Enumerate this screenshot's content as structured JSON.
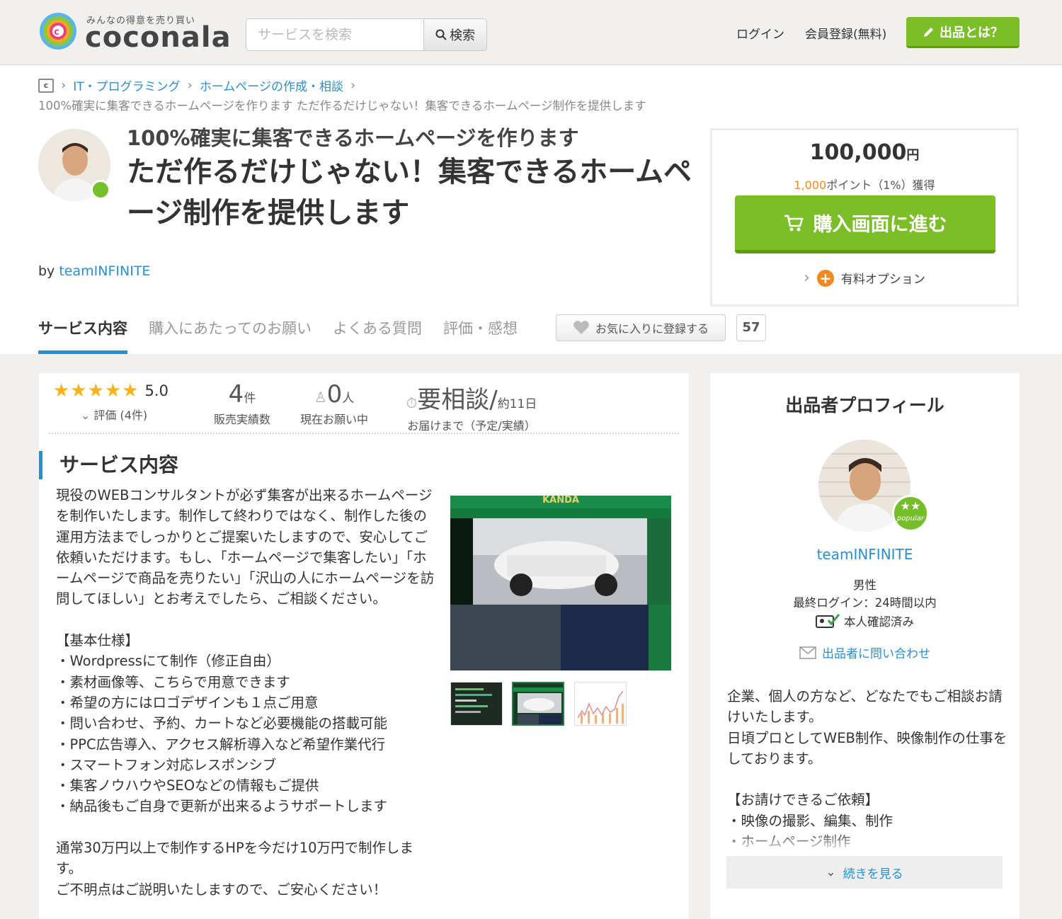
{
  "header": {
    "logo_tagline": "みんなの得意を売り買い",
    "logo_word": "coconala",
    "search_placeholder": "サービスを検索",
    "search_button": "検索",
    "login": "ログイン",
    "register": "会員登録(無料)",
    "sell_button": "出品とは？"
  },
  "breadcrumb": {
    "items": [
      "IT・プログラミング",
      "ホームページの作成・相談"
    ],
    "current": "100%確実に集客できるホームページを作ります ただ作るだけじゃない！集客できるホームページ制作を提供します"
  },
  "service": {
    "title_sub": "100%確実に集客できるホームページを作ります",
    "title_main": "ただ作るだけじゃない！集客できるホームページ制作を提供します",
    "by_label": "by",
    "seller": "teamINFINITE"
  },
  "price_box": {
    "price": "100,000",
    "currency": "円",
    "points_value": "1,000",
    "points_text": "ポイント（1%）獲得",
    "buy_button": "購入画面に進む",
    "option_label": "有料オプション"
  },
  "tabs": [
    {
      "label": "サービス内容",
      "active": true
    },
    {
      "label": "購入にあたってのお願い",
      "active": false
    },
    {
      "label": "よくある質問",
      "active": false
    },
    {
      "label": "評価・感想",
      "active": false
    }
  ],
  "favorite": {
    "label": "お気に入りに登録する",
    "count": "57"
  },
  "stats": {
    "rating_stars": "★★★★★",
    "rating_score": "5.0",
    "rating_label": "評価 (4件)",
    "sales_count": "4",
    "sales_unit": "件",
    "sales_label": "販売実績数",
    "requests_count": "0",
    "requests_unit": "人",
    "requests_label": "現在お願い中",
    "delivery_value": "要相談",
    "delivery_sep": "/",
    "delivery_actual": "約11日",
    "delivery_label": "お届けまで（予定/実績）"
  },
  "content": {
    "section_title": "サービス内容",
    "description": "現役のWEBコンサルタントが必ず集客が出来るホームページを制作いたします。制作して終わりではなく、制作した後の運用方法までしっかりとご提案いたしますので、安心してご依頼いただけます。もし、「ホームページで集客したい」「ホームページで商品を売りたい」「沢山の人にホームページを訪問してほしい」とお考えでしたら、ご相談ください。\n\n【基本仕様】\n・Wordpressにて制作（修正自由）\n・素材画像等、こちらで用意できます\n・希望の方にはロゴデザインも１点ご用意\n・問い合わせ、予約、カートなど必要機能の搭載可能\n・PPC広告導入、アクセス解析導入など希望作業代行\n・スマートフォン対応レスポンシブ\n・集客ノウハウやSEOなどの情報もご提供\n・納品後もご自身で更新が出来るようサポートします\n\n通常30万円以上で制作するHPを今だけ10万円で制作します。\nご不明点はご説明いたしますので、ご安心ください！",
    "gallery_brand": "KANDA"
  },
  "profile": {
    "heading": "出品者プロフィール",
    "name": "teamINFINITE",
    "badge": "popular",
    "gender": "男性",
    "last_login": "最終ログイン：24時間以内",
    "verified": "本人確認済み",
    "contact": "出品者に問い合わせ",
    "description": "企業、個人の方など、どなたでもご相談お請けいたします。\n日頃プロとしてWEB制作、映像制作の仕事をしております。\n\n【お請けできるご依頼】\n・映像の撮影、編集、制作\n・ホームページ制作",
    "more": "続きを見る"
  }
}
